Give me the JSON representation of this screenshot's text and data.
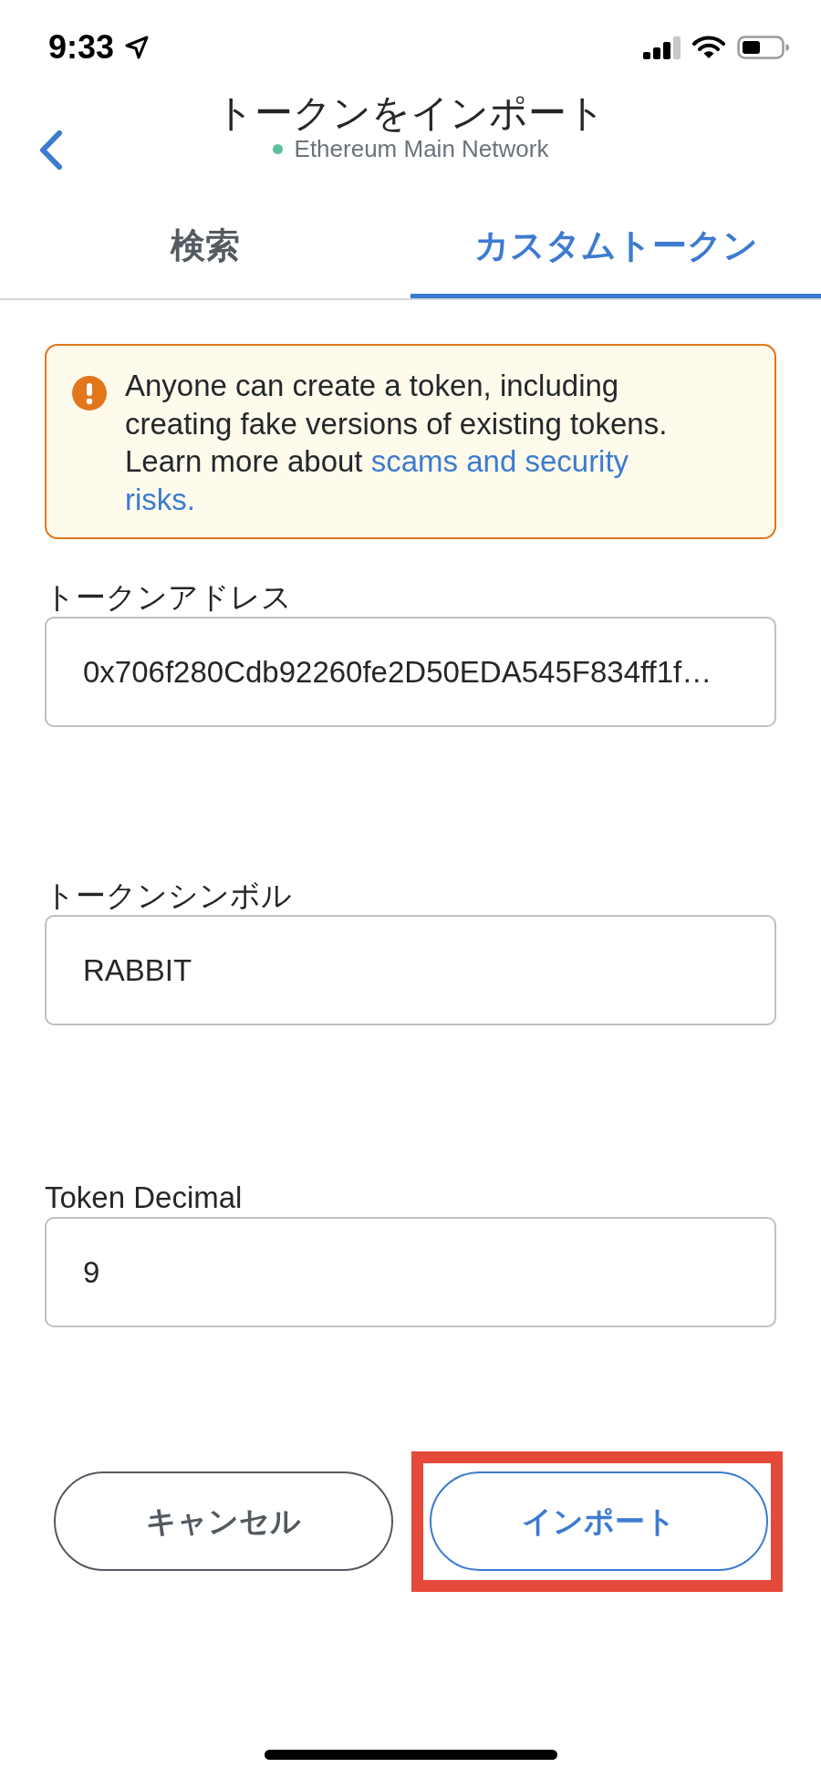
{
  "status_bar": {
    "time": "9:33"
  },
  "header": {
    "title": "トークンをインポート",
    "network": "Ethereum Main Network"
  },
  "tabs": [
    {
      "label": "検索",
      "selected": false
    },
    {
      "label": "カスタムトークン",
      "selected": true
    }
  ],
  "warning": {
    "text": "Anyone can create a token, including creating fake versions of existing tokens. Learn more about",
    "link": "scams and security risks."
  },
  "fields": [
    {
      "label": "トークンアドレス",
      "value": "0x706f280Cdb92260fe2D50EDA545F834ff1f…"
    },
    {
      "label": "トークンシンボル",
      "value": "RABBIT"
    },
    {
      "label": "Token Decimal",
      "value": "9"
    }
  ],
  "buttons": [
    {
      "label": "キャンセル",
      "kind": "secondary",
      "highlighted": false
    },
    {
      "label": "インポート",
      "kind": "primary",
      "highlighted": true
    }
  ]
}
